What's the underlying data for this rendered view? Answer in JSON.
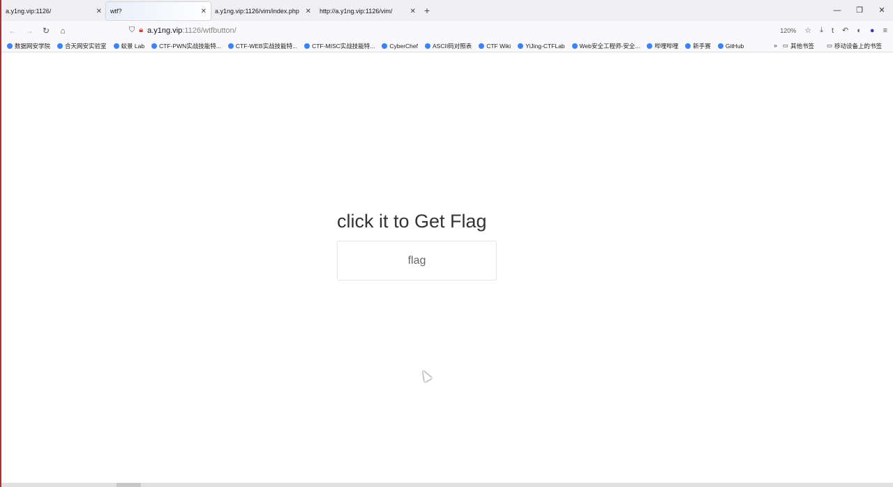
{
  "tabs": [
    {
      "label": "a.y1ng.vip:1126/",
      "active": false
    },
    {
      "label": "wtf?",
      "active": true
    },
    {
      "label": "a.y1ng.vip:1126/vim/index.php",
      "active": false
    },
    {
      "label": "http://a.y1ng.vip:1126/vim/",
      "active": false
    }
  ],
  "url": {
    "host": "a.y1ng.vip",
    "rest": ":1126/wtfbutton/"
  },
  "zoom": "120%",
  "bookmarks": [
    "数据网安学院",
    "合天网安实验室",
    "蚁景 Lab",
    "CTF-PWN实战技能特...",
    "CTF-WEB实战技能特...",
    "CTF-MISC实战技能特...",
    "CyberChef",
    "ASCII码对照表",
    "CTF Wiki",
    "YiJing-CTFLab",
    "Web安全工程师-安全...",
    "哔哩哔哩",
    "新手赛",
    "GitHub"
  ],
  "bookmarks_right": [
    "其他书签",
    "移动设备上的书签"
  ],
  "page": {
    "title": "click it to Get Flag",
    "button": "flag"
  }
}
